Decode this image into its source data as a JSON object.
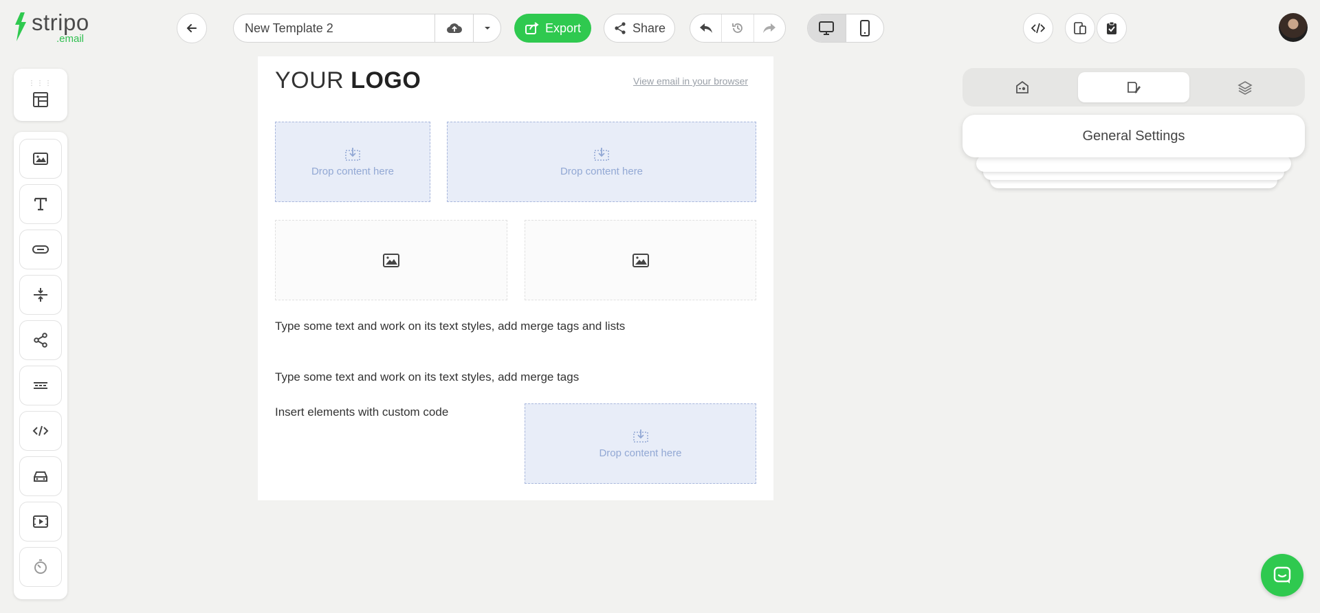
{
  "brand": {
    "name": "stripo",
    "sub": ".email",
    "accent": "#2fc94f"
  },
  "toolbar": {
    "back_icon": "arrow-left-icon",
    "template_name": "New Template 2",
    "export_label": "Export",
    "share_label": "Share"
  },
  "sidebar": {
    "structure_icon": "structure-icon",
    "blocks": [
      {
        "name": "image-block",
        "icon": "image-icon"
      },
      {
        "name": "text-block",
        "icon": "text-icon"
      },
      {
        "name": "button-block",
        "icon": "button-icon"
      },
      {
        "name": "spacer-block",
        "icon": "spacer-icon"
      },
      {
        "name": "social-block",
        "icon": "share-icon"
      },
      {
        "name": "menu-block",
        "icon": "menu-icon"
      },
      {
        "name": "html-block",
        "icon": "code-icon"
      },
      {
        "name": "amp-block",
        "icon": "car-icon"
      },
      {
        "name": "video-block",
        "icon": "video-icon"
      },
      {
        "name": "timer-block",
        "icon": "timer-icon"
      }
    ]
  },
  "canvas": {
    "logo_regular": "YOUR",
    "logo_bold": "LOGO",
    "view_in_browser": "View email in your browser",
    "drop_label": "Drop content here",
    "text1": "Type some text and work on its text styles, add merge tags and lists",
    "text2": "Type some text and work on its text styles, add merge tags",
    "text3": "Insert elements with custom code"
  },
  "panel": {
    "tabs": [
      "appearance",
      "settings",
      "layers"
    ],
    "general_settings": "General Settings"
  }
}
